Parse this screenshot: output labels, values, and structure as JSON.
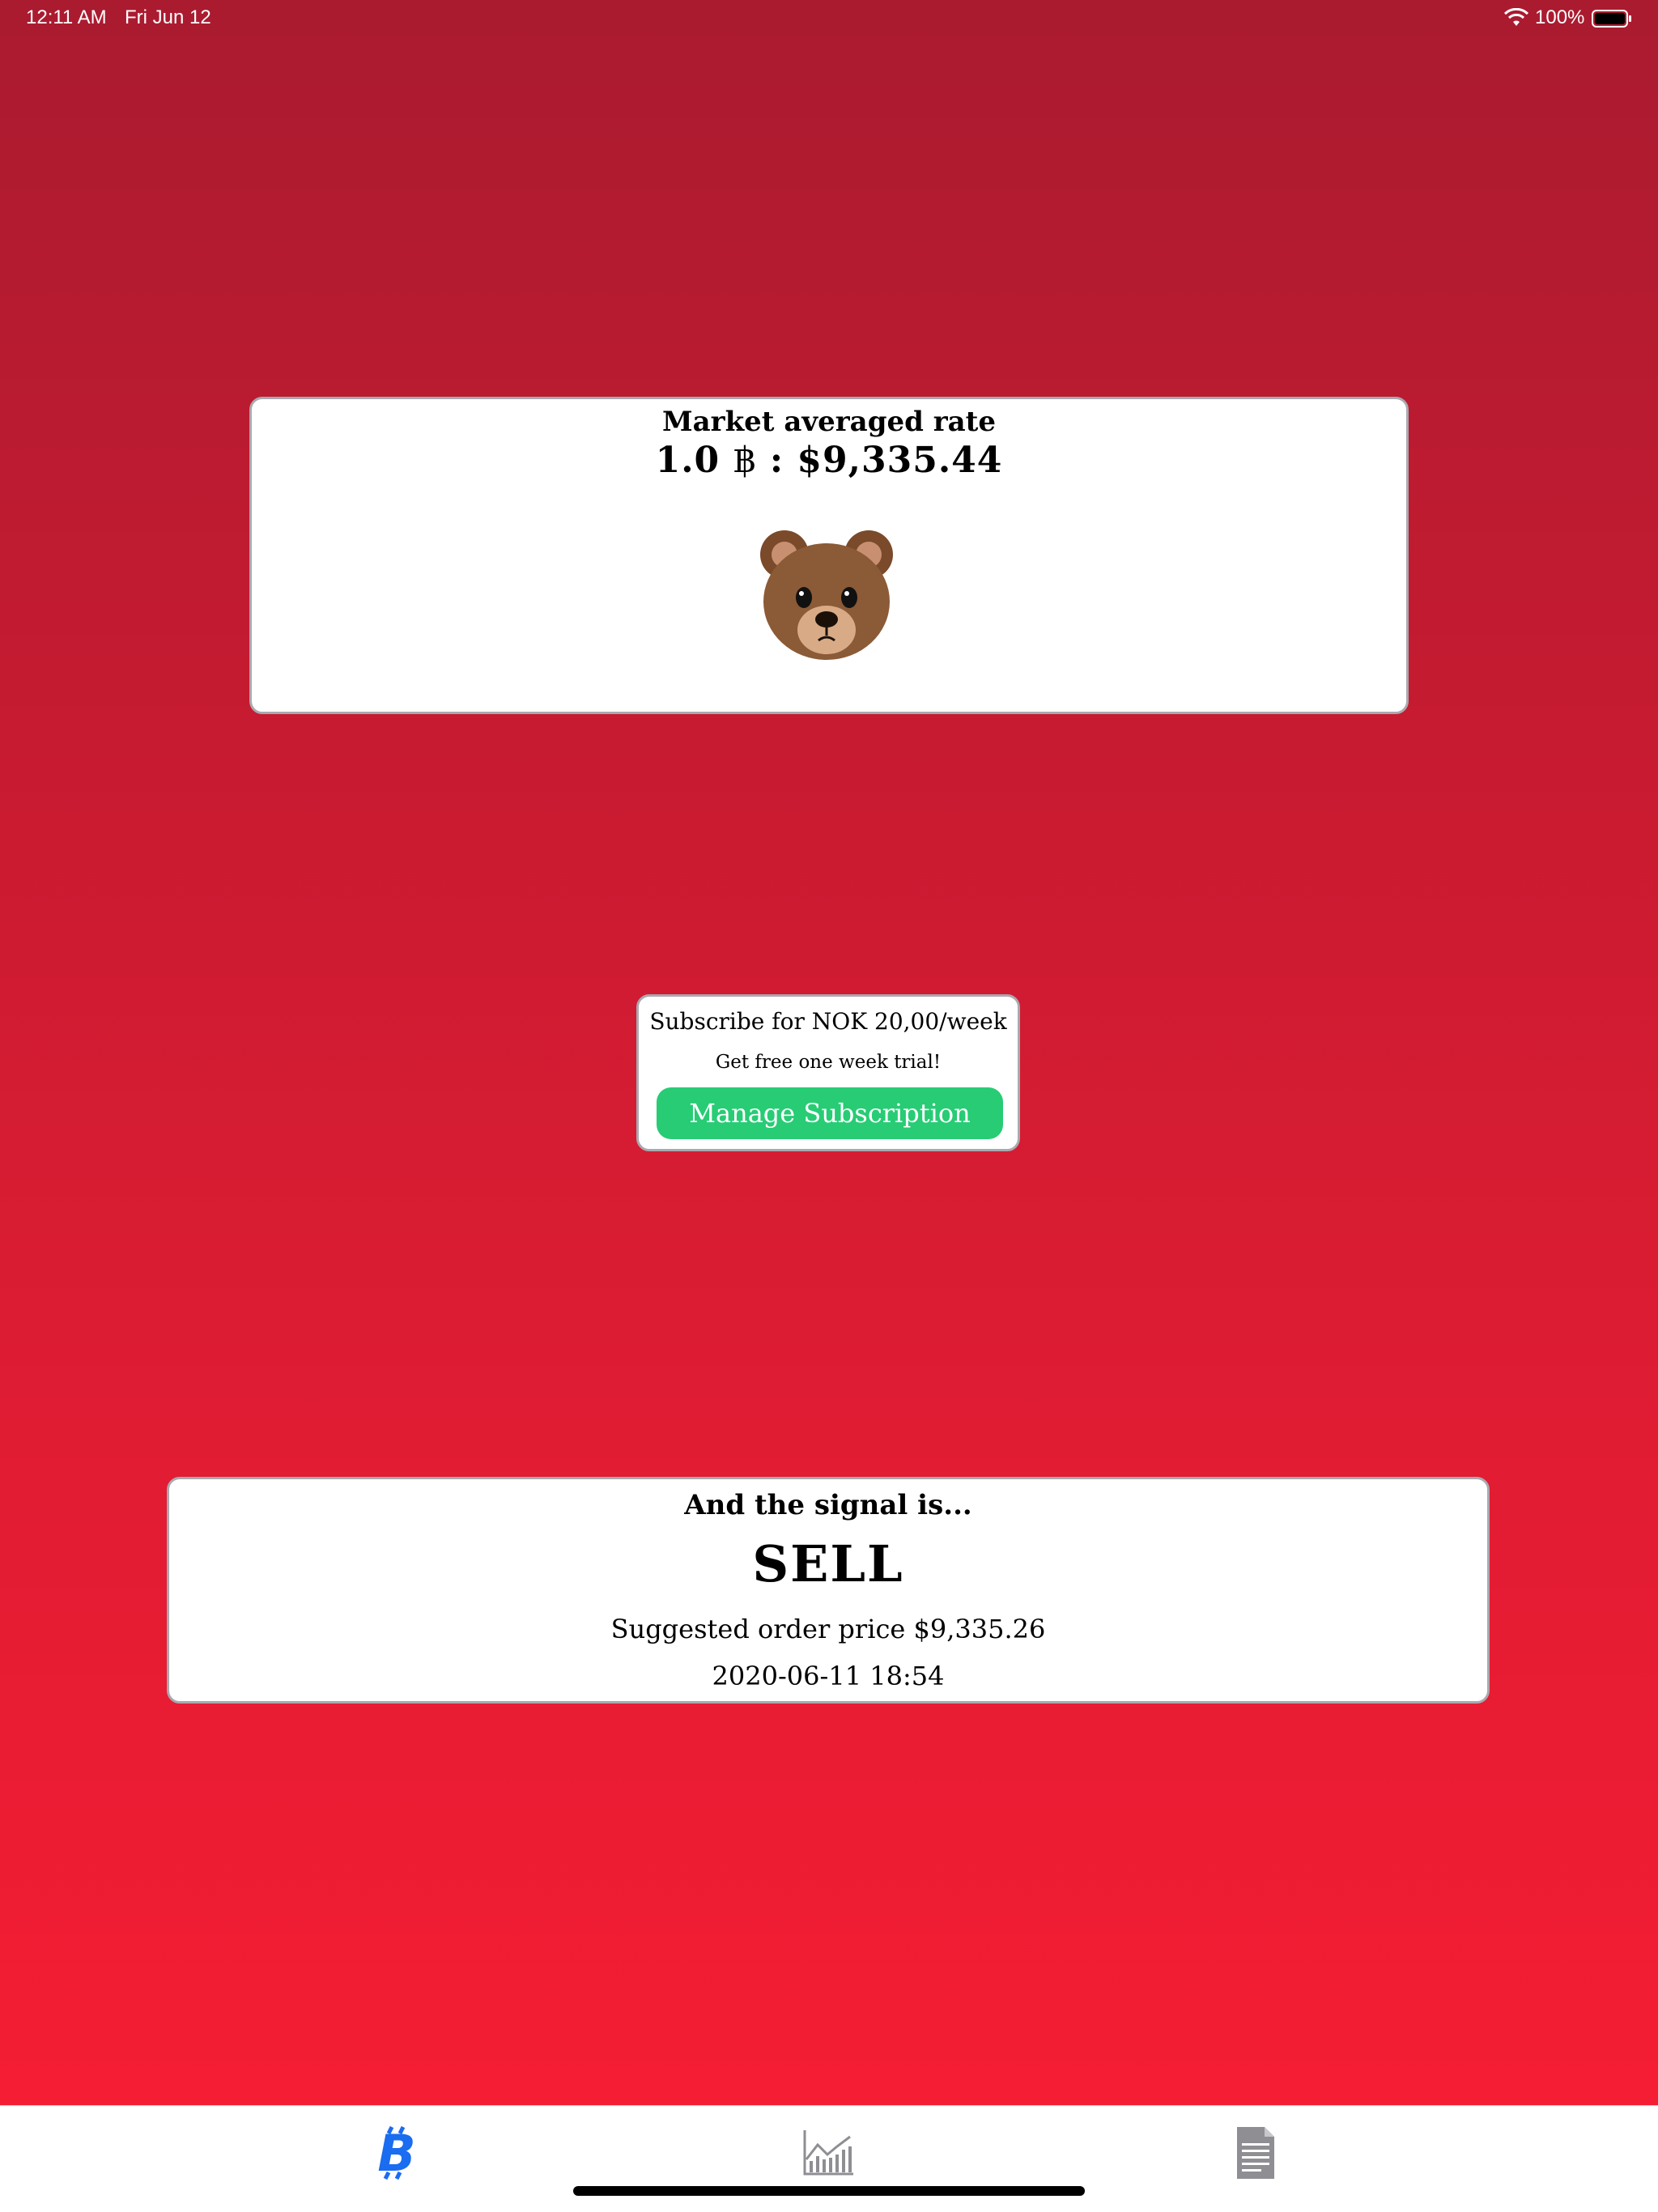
{
  "status_bar": {
    "time": "12:11 AM",
    "date": "Fri Jun 12",
    "battery": "100%"
  },
  "rate_card": {
    "title": "Market averaged rate",
    "amount": "1.0",
    "currency_symbol": "฿",
    "separator": ":",
    "price": "$9,335.44",
    "icon": "bear-face-icon"
  },
  "subscription": {
    "offer": "Subscribe for NOK 20,00/week",
    "trial": "Get free one week trial!",
    "button_label": "Manage Subscription"
  },
  "signal_card": {
    "heading": "And the signal is...",
    "signal": "SELL",
    "suggested_price": "Suggested order price $9,335.26",
    "timestamp": "2020-06-11 18:54"
  },
  "tab_bar": {
    "tabs": [
      {
        "icon": "bitcoin-icon",
        "active": true
      },
      {
        "icon": "chart-icon",
        "active": false
      },
      {
        "icon": "document-icon",
        "active": false
      }
    ]
  },
  "colors": {
    "background_top": "#aa1b30",
    "background_bottom": "#f81d33",
    "button": "#27cc74",
    "active_tab": "#1a6cf0",
    "inactive_tab": "#8e8e93"
  }
}
